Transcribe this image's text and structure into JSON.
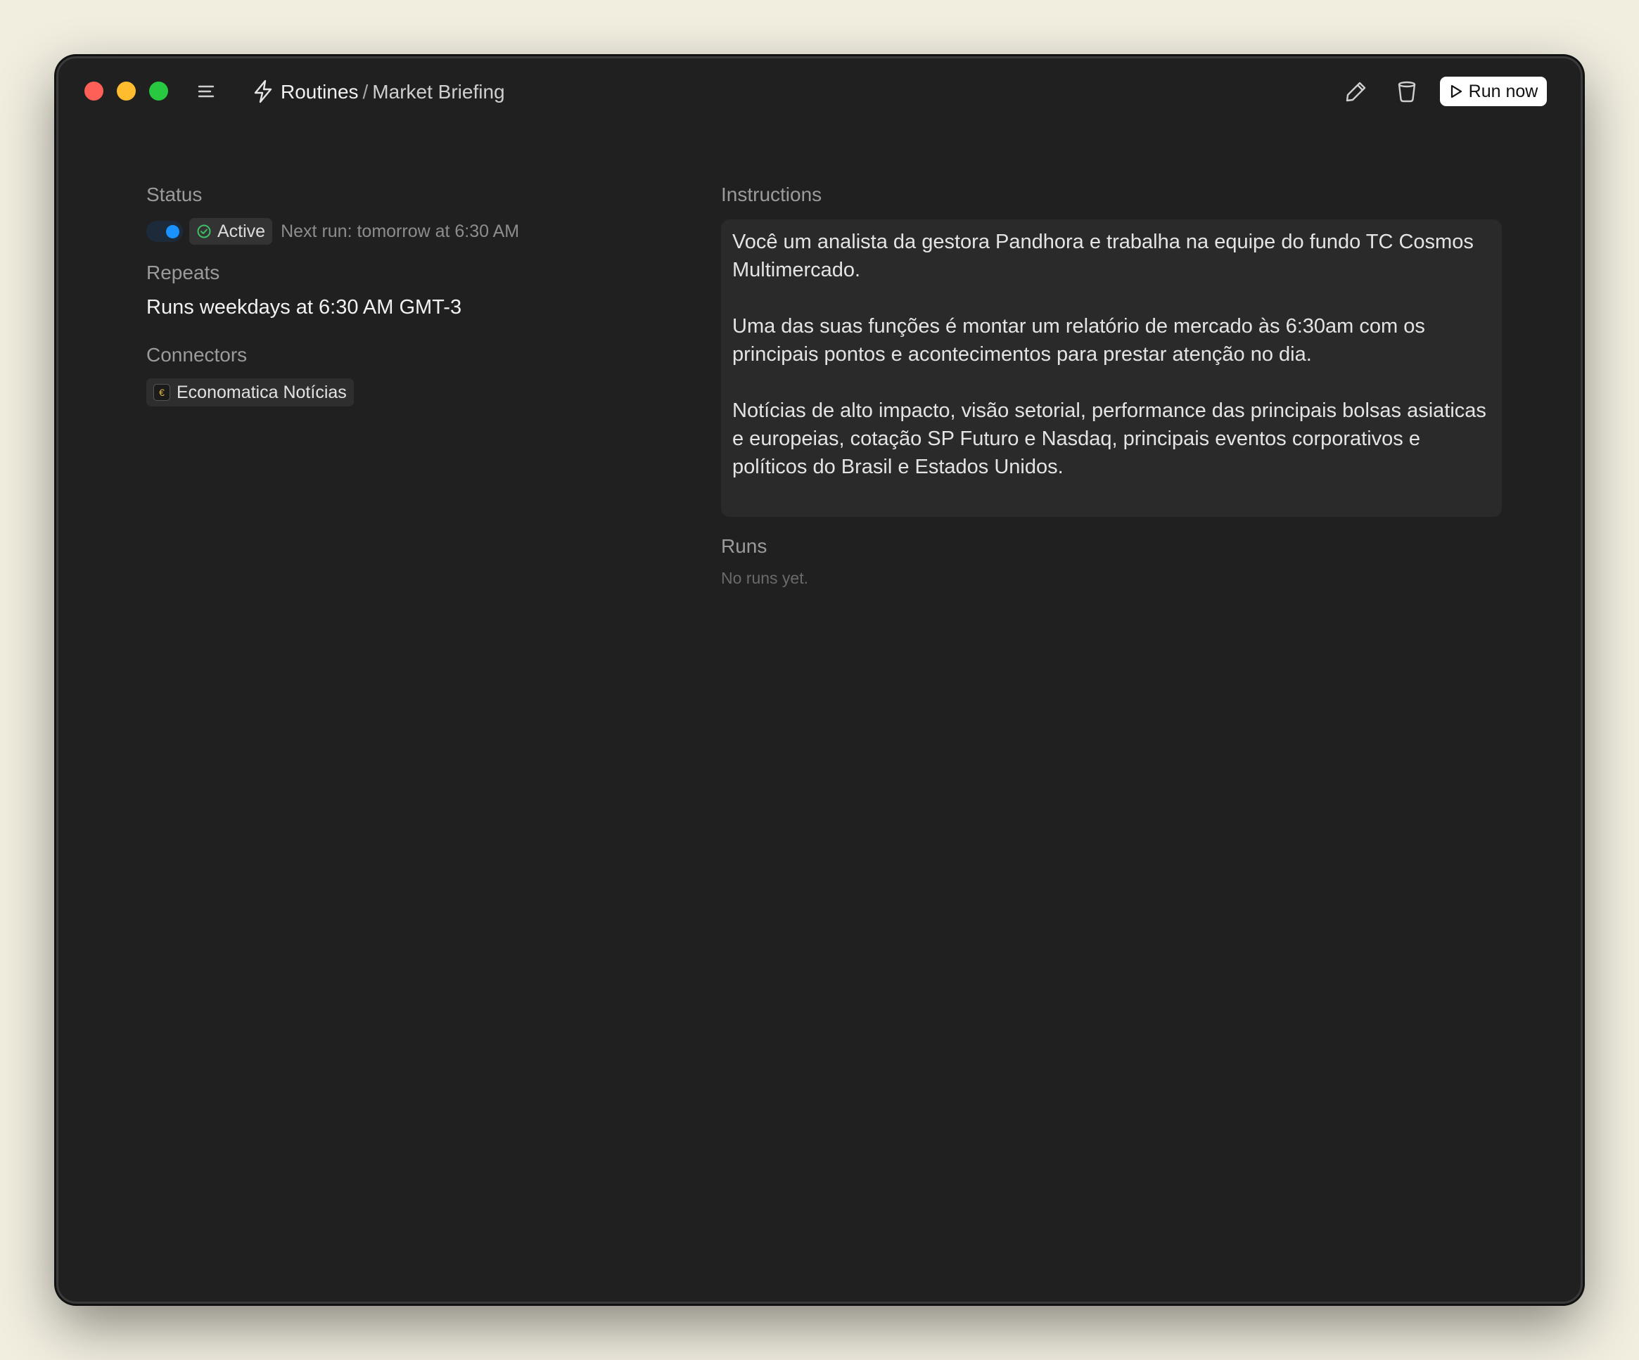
{
  "header": {
    "breadcrumb_root": "Routines",
    "breadcrumb_separator": "/",
    "breadcrumb_current": "Market Briefing",
    "run_now_label": "Run now",
    "icons": [
      "menu-icon",
      "lightning-bolt-icon",
      "pencil-icon",
      "trash-icon",
      "play-icon"
    ]
  },
  "status": {
    "label": "Status",
    "toggle_on": true,
    "badge": "Active",
    "next_run": "Next run: tomorrow at 6:30 AM"
  },
  "repeats": {
    "label": "Repeats",
    "value": "Runs weekdays at 6:30 AM GMT-3"
  },
  "connectors": {
    "label": "Connectors",
    "items": [
      {
        "name": "Economatica Notícias"
      }
    ]
  },
  "instructions": {
    "label": "Instructions",
    "paragraphs": [
      "Você um analista da gestora Pandhora e trabalha na equipe do fundo TC Cosmos Multimercado.",
      "Uma das suas funções é montar um relatório de mercado às 6:30am com os principais pontos e acontecimentos para prestar atenção no dia.",
      "Notícias de alto impacto, visão setorial, performance das principais bolsas asiaticas e europeias, cotação SP Futuro e Nasdaq, principais eventos corporativos e políticos do Brasil e Estados Unidos."
    ]
  },
  "runs": {
    "label": "Runs",
    "empty_text": "No runs yet."
  },
  "colors": {
    "window_bg": "#202020",
    "page_bg": "#f1eee0",
    "accent_blue": "#1a93ff",
    "active_green": "#3fbf63"
  }
}
